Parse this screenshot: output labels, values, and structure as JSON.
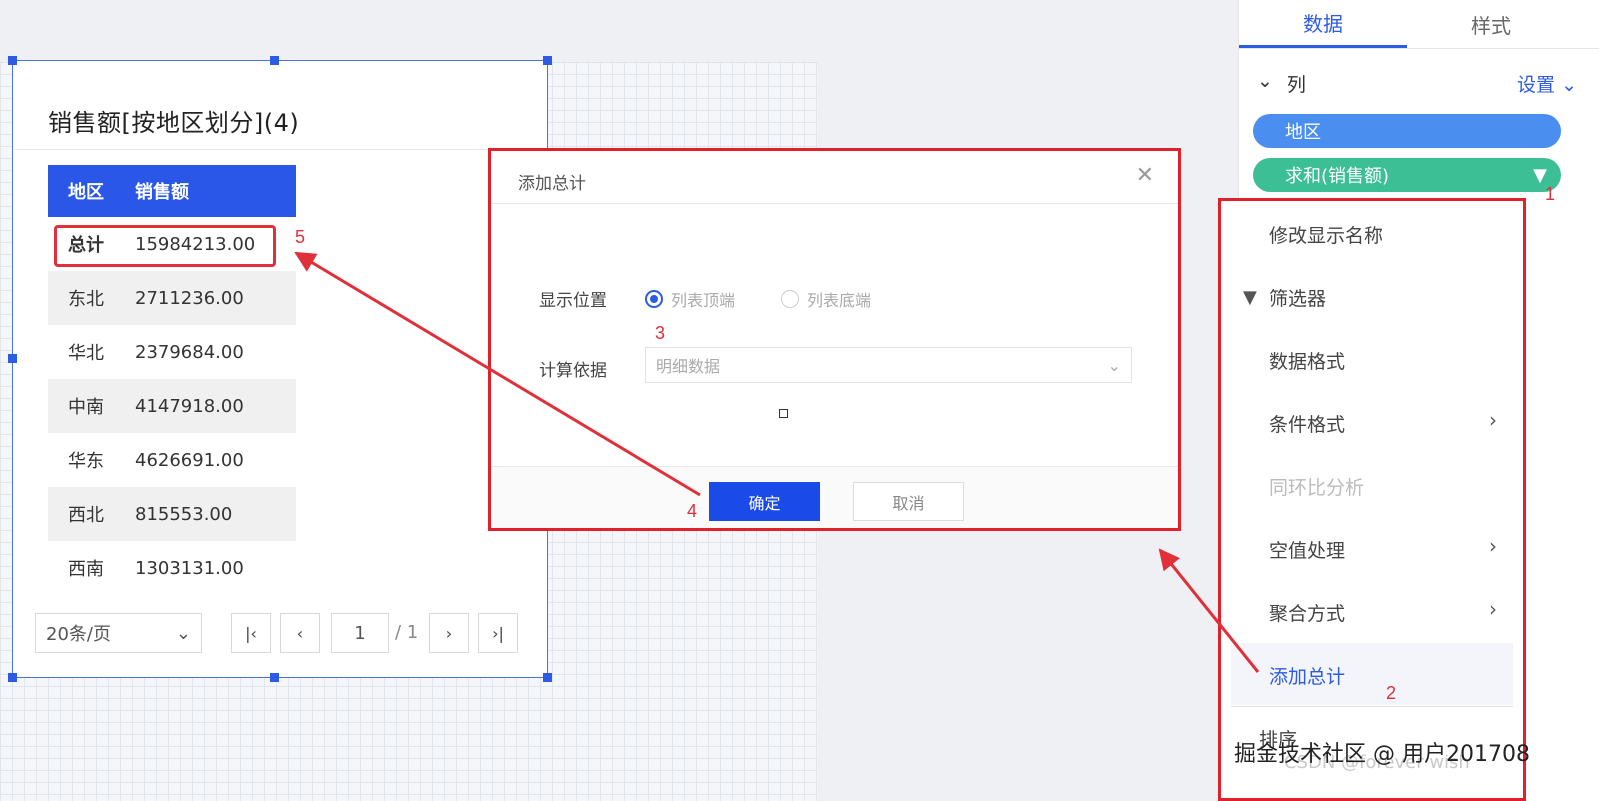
{
  "widget": {
    "title": "销售额[按地区划分](4)",
    "table": {
      "headers": [
        "地区",
        "销售额"
      ],
      "rows": [
        [
          "总计",
          "15984213.00"
        ],
        [
          "东北",
          "2711236.00"
        ],
        [
          "华北",
          "2379684.00"
        ],
        [
          "中南",
          "4147918.00"
        ],
        [
          "华东",
          "4626691.00"
        ],
        [
          "西北",
          "815553.00"
        ],
        [
          "西南",
          "1303131.00"
        ]
      ]
    },
    "pager": {
      "page_size": "20条/页",
      "current_page": "1",
      "total_pages": "/ 1",
      "first_icon": "first-page-icon",
      "prev_icon": "chevron-left-icon",
      "next_icon": "chevron-right-icon",
      "last_icon": "last-page-icon"
    }
  },
  "dialog": {
    "title": "添加总计",
    "position_label": "显示位置",
    "option_top": "列表顶端",
    "option_bottom": "列表底端",
    "basis_label": "计算依据",
    "basis_value": "明细数据",
    "ok_label": "确定",
    "cancel_label": "取消",
    "close_icon": "close-icon"
  },
  "panel": {
    "tab_data": "数据",
    "tab_style": "样式",
    "columns_label": "列",
    "settings_label": "设置",
    "field_region": "地区",
    "field_sales": "求和(销售额)"
  },
  "menu": {
    "items": [
      "修改显示名称",
      "筛选器",
      "数据格式",
      "条件格式",
      "同环比分析",
      "空值处理",
      "聚合方式",
      "添加总计",
      "排序"
    ]
  },
  "annotations": [
    "1",
    "2",
    "3",
    "4",
    "5"
  ],
  "watermark": "掘金技术社区 @ 用户201708",
  "watermark_faint": "CSDN @forever wish",
  "colors": {
    "primary": "#2d5be3",
    "header_blue": "#2b57e8",
    "pill_blue": "#4a8ff0",
    "pill_green": "#3cbf94",
    "annotation_red": "#e0303a"
  }
}
